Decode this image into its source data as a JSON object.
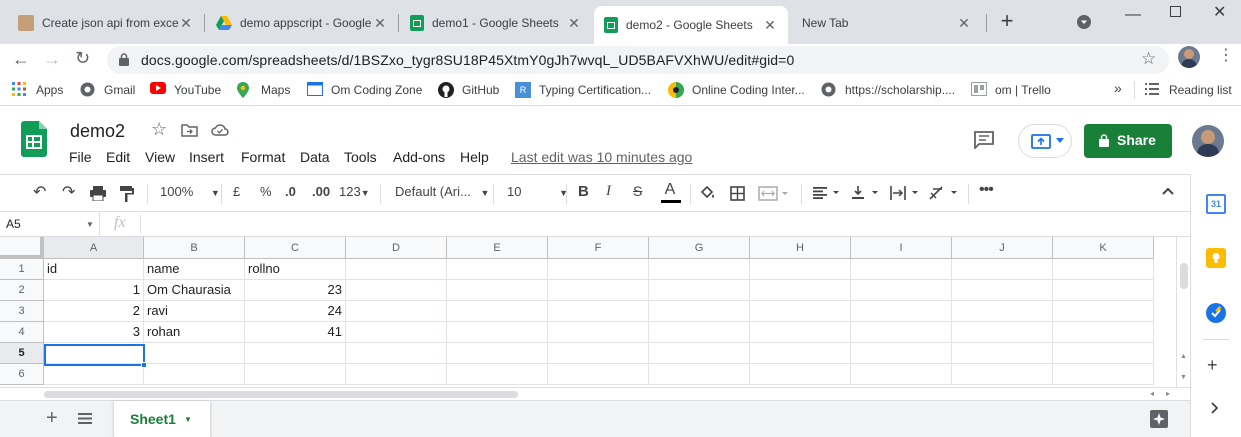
{
  "browser": {
    "tabs": [
      {
        "title": "Create json api from exce",
        "icon": "youtube-thumb-icon"
      },
      {
        "title": "demo appscript - Google",
        "icon": "google-drive-icon"
      },
      {
        "title": "demo1 - Google Sheets",
        "icon": "google-sheets-icon"
      },
      {
        "title": "demo2 - Google Sheets",
        "icon": "google-sheets-icon",
        "active": true
      },
      {
        "title": "New Tab",
        "icon": ""
      }
    ],
    "new_tab_symbol": "+",
    "url": "docs.google.com/spreadsheets/d/1BSZxo_tygr8SU18P45XtmY0gJh7wvqL_UD5BAFVXhWU/edit#gid=0"
  },
  "bookmarks": {
    "items": [
      "Apps",
      "Gmail",
      "YouTube",
      "Maps",
      "Om Coding Zone",
      "GitHub",
      "Typing Certification...",
      "Online Coding Inter...",
      "https://scholarship....",
      "om | Trello"
    ],
    "overflow": "»",
    "reading_list": "Reading list"
  },
  "doc": {
    "title": "demo2",
    "menus": [
      "File",
      "Edit",
      "View",
      "Insert",
      "Format",
      "Data",
      "Tools",
      "Add-ons",
      "Help"
    ],
    "last_edit": "Last edit was 10 minutes ago",
    "share_label": "Share"
  },
  "toolbar": {
    "zoom": "100%",
    "currency": "£",
    "percent": "%",
    "dec_less": ".0",
    "dec_more": ".00",
    "more_formats": "123",
    "font": "Default (Ari...",
    "font_size": "10",
    "bold": "B",
    "italic": "I",
    "underline_text": "A"
  },
  "formula_bar": {
    "cell_ref": "A5",
    "fx": "fx",
    "value": ""
  },
  "grid": {
    "columns": [
      "A",
      "B",
      "C",
      "D",
      "E",
      "F",
      "G",
      "H",
      "I",
      "J",
      "K"
    ],
    "rows": [
      "1",
      "2",
      "3",
      "4",
      "5",
      "6"
    ],
    "cells": [
      [
        "id",
        "name",
        "rollno"
      ],
      [
        "1",
        "Om Chaurasia",
        "23"
      ],
      [
        "2",
        "ravi",
        "24"
      ],
      [
        "3",
        "rohan",
        "41"
      ],
      [
        "",
        "",
        ""
      ],
      [
        "",
        "",
        ""
      ]
    ]
  },
  "sheets": {
    "tabs": [
      "Sheet1"
    ],
    "add_symbol": "+"
  },
  "colors": {
    "sheets_green": "#0f9d58",
    "share_green": "#188038",
    "selection_blue": "#1a73e8"
  }
}
